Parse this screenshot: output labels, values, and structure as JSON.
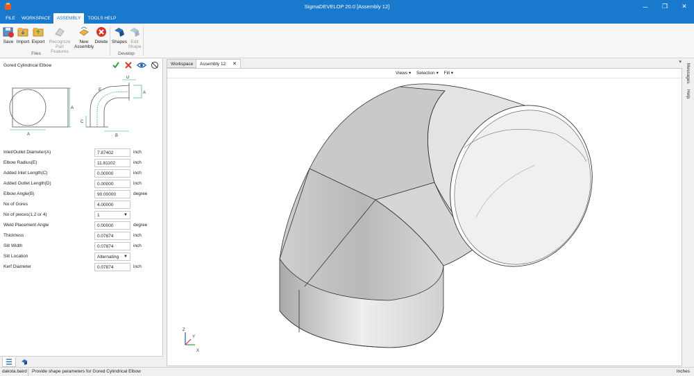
{
  "window": {
    "title": "SigmaDEVELOP 20.0 [Assembly 12]",
    "controls": [
      "─",
      "❐",
      "✕"
    ]
  },
  "menu": {
    "tabs": [
      "FILE",
      "WORKSPACE",
      "ASSEMBLY",
      "TOOLS HELP"
    ],
    "active": "ASSEMBLY"
  },
  "ribbon": {
    "files_group": "Files",
    "develop_group": "Develop",
    "save": "Save",
    "import": "Import",
    "export": "Export",
    "recognize_l1": "Recognize",
    "recognize_l2": "Part Features",
    "new_assembly_l1": "New",
    "new_assembly_l2": "Assembly",
    "delete": "Delete",
    "shapes": "Shapes",
    "edit_shape_l1": "Edit",
    "edit_shape_l2": "Shape"
  },
  "panel": {
    "title": "Gored Cylindrical Elbow",
    "diagram_labels": {
      "a": "A",
      "b": "B",
      "c": "C",
      "d": "D",
      "e": "E"
    },
    "fields": [
      {
        "label": "Inlet/Outlet Diameter(A)",
        "value": "7.87402",
        "unit": "inch"
      },
      {
        "label": "Elbow Radius(E)",
        "value": "11.81102",
        "unit": "inch"
      },
      {
        "label": "Added Inlet Length(C)",
        "value": "0.00000",
        "unit": "inch"
      },
      {
        "label": "Added Outlet Length(D)",
        "value": "0.00000",
        "unit": "inch"
      },
      {
        "label": "Elbow Angle(B)",
        "value": "90.00000",
        "unit": "degree"
      },
      {
        "label": "No of Gores",
        "value": "4.00000",
        "unit": ""
      },
      {
        "label": "No of pieces(1,2 or 4)",
        "value": "1",
        "unit": ""
      },
      {
        "label": "Weld Placement Angle",
        "value": "0.00000",
        "unit": "degree"
      },
      {
        "label": "Thickness",
        "value": "0.07874",
        "unit": "inch"
      },
      {
        "label": "Slit Width",
        "value": "0.07874",
        "unit": "inch"
      },
      {
        "label": "Slit Location",
        "value": "Alternating",
        "unit": ""
      },
      {
        "label": "Kerf Diameter",
        "value": "0.07874",
        "unit": "inch"
      }
    ]
  },
  "document": {
    "tabs": [
      "Workspace",
      "Assembly 12"
    ],
    "close_glyph": "✕",
    "view_menus": [
      "Views ▾",
      "Selection ▾",
      "Fill ▾"
    ],
    "axis": {
      "x": "X",
      "y": "Y",
      "z": "Z"
    }
  },
  "side_panels": [
    "Messages",
    "Help"
  ],
  "status": {
    "user": "dakota.baird",
    "message": "Provide shape parameters for Gored Cylindrical Elbow",
    "units": "Inches"
  },
  "colors": {
    "accent": "#1879cd",
    "confirm": "#2e9e3e",
    "cancel": "#d9342b",
    "dimension": "#1b9a8a"
  }
}
